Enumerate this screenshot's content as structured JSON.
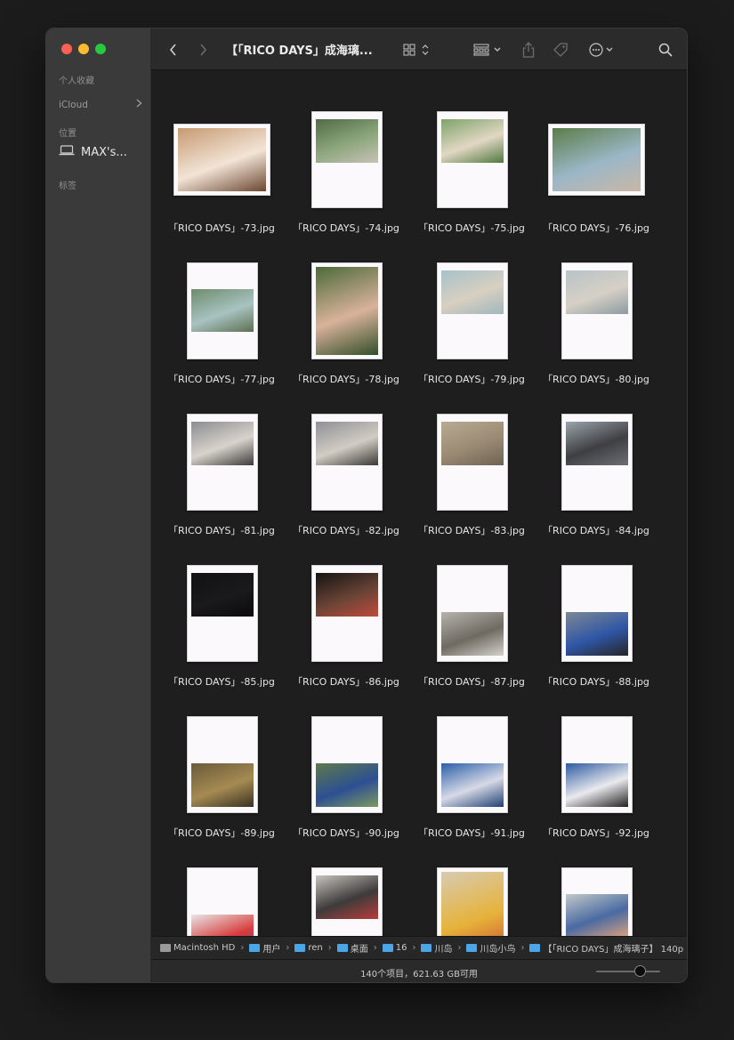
{
  "window": {
    "title": "【「RICO DAYS」成海璃...",
    "traffic_lights": [
      "#fe5f57",
      "#febc2e",
      "#28c840"
    ]
  },
  "sidebar": {
    "favorites_label": "个人收藏",
    "icloud_label": "iCloud",
    "locations_label": "位置",
    "device_name": "MAX's...",
    "tags_label": "标签"
  },
  "toolbar": {
    "back_icon": "chevron-left-icon",
    "forward_icon": "chevron-right-icon",
    "view_icon": "grid-view-icon",
    "group_icon": "group-icon",
    "share_icon": "share-icon",
    "tag_icon": "tag-icon",
    "more_icon": "ellipsis-circle-icon",
    "search_icon": "search-icon"
  },
  "files": [
    {
      "name": "「RICO DAYS」-73.jpg",
      "orient": "landscape",
      "photo": "full",
      "colors": [
        "#c79a72",
        "#f2e4d6",
        "#6b4630"
      ]
    },
    {
      "name": "「RICO DAYS」-74.jpg",
      "orient": "portrait",
      "photo": "top",
      "colors": [
        "#4f6c46",
        "#8ea77e",
        "#c7c2b6"
      ]
    },
    {
      "name": "「RICO DAYS」-75.jpg",
      "orient": "portrait",
      "photo": "top",
      "colors": [
        "#7ea36a",
        "#e2d7c4",
        "#4e7a3e"
      ]
    },
    {
      "name": "「RICO DAYS」-76.jpg",
      "orient": "landscape",
      "photo": "full",
      "colors": [
        "#5c7d49",
        "#9bb7c7",
        "#c9b7a6"
      ]
    },
    {
      "name": "「RICO DAYS」-77.jpg",
      "orient": "portrait",
      "photo": "middle",
      "colors": [
        "#6e8b6d",
        "#a8c3c1",
        "#5d6f52"
      ]
    },
    {
      "name": "「RICO DAYS」-78.jpg",
      "orient": "portrait",
      "photo": "full",
      "colors": [
        "#4d6a3b",
        "#d9b29a",
        "#324f2a"
      ]
    },
    {
      "name": "「RICO DAYS」-79.jpg",
      "orient": "portrait",
      "photo": "top",
      "colors": [
        "#a7c2c9",
        "#d8cfc1",
        "#9fb7bb"
      ]
    },
    {
      "name": "「RICO DAYS」-80.jpg",
      "orient": "portrait",
      "photo": "top",
      "colors": [
        "#b8c3c7",
        "#d6d0c6",
        "#8c9aa1"
      ]
    },
    {
      "name": "「RICO DAYS」-81.jpg",
      "orient": "portrait",
      "photo": "top",
      "colors": [
        "#8b8d92",
        "#d8d3cb",
        "#3b3a3a"
      ]
    },
    {
      "name": "「RICO DAYS」-82.jpg",
      "orient": "portrait",
      "photo": "top",
      "colors": [
        "#8f9196",
        "#d1ccc3",
        "#3a3836"
      ]
    },
    {
      "name": "「RICO DAYS」-83.jpg",
      "orient": "portrait",
      "photo": "top",
      "colors": [
        "#b8aa94",
        "#9a8a74",
        "#6d6253"
      ]
    },
    {
      "name": "「RICO DAYS」-84.jpg",
      "orient": "portrait",
      "photo": "top",
      "colors": [
        "#9aa3ad",
        "#3f3f42",
        "#6a6f76"
      ]
    },
    {
      "name": "「RICO DAYS」-85.jpg",
      "orient": "portrait",
      "photo": "top",
      "colors": [
        "#111012",
        "#1a1a1c",
        "#0b0b0b"
      ]
    },
    {
      "name": "「RICO DAYS」-86.jpg",
      "orient": "portrait",
      "photo": "top",
      "colors": [
        "#151314",
        "#6a4436",
        "#c14a3a"
      ]
    },
    {
      "name": "「RICO DAYS」-87.jpg",
      "orient": "portrait",
      "photo": "bottom",
      "colors": [
        "#b4b4ad",
        "#6f6a61",
        "#d4d2cc"
      ]
    },
    {
      "name": "「RICO DAYS」-88.jpg",
      "orient": "portrait",
      "photo": "bottom",
      "colors": [
        "#7d8894",
        "#2f56a6",
        "#252525"
      ]
    },
    {
      "name": "「RICO DAYS」-89.jpg",
      "orient": "portrait",
      "photo": "bottom",
      "colors": [
        "#6b5a3b",
        "#a58b52",
        "#3a3124"
      ]
    },
    {
      "name": "「RICO DAYS」-90.jpg",
      "orient": "portrait",
      "photo": "bottom",
      "colors": [
        "#5e7b4a",
        "#2d4f93",
        "#7d9a5f"
      ]
    },
    {
      "name": "「RICO DAYS」-91.jpg",
      "orient": "portrait",
      "photo": "bottom",
      "colors": [
        "#2b5fa8",
        "#d7d9e6",
        "#1e3f75"
      ]
    },
    {
      "name": "「RICO DAYS」-92.jpg",
      "orient": "portrait",
      "photo": "bottom",
      "colors": [
        "#2c5aa0",
        "#eaeaee",
        "#222222"
      ]
    },
    {
      "name": "",
      "orient": "portrait",
      "photo": "bottom",
      "colors": [
        "#e7e7e7",
        "#d93a3a",
        "#2f5fb1"
      ]
    },
    {
      "name": "",
      "orient": "portrait",
      "photo": "top",
      "colors": [
        "#c7c3bd",
        "#3d3b3b",
        "#b73d3b"
      ]
    },
    {
      "name": "",
      "orient": "portrait",
      "photo": "full",
      "colors": [
        "#d8cbb1",
        "#e6b23a",
        "#c94a2f"
      ]
    },
    {
      "name": "",
      "orient": "portrait",
      "photo": "middle",
      "colors": [
        "#c2c9c9",
        "#4a6aa2",
        "#d9a17f"
      ]
    }
  ],
  "pathbar": {
    "items": [
      {
        "label": "Macintosh HD",
        "icon": "hard-drive-icon"
      },
      {
        "label": "用户",
        "icon": "folder-icon"
      },
      {
        "label": "ren",
        "icon": "folder-icon"
      },
      {
        "label": "桌面",
        "icon": "folder-icon"
      },
      {
        "label": "16\u0000",
        "icon": "folder-icon"
      },
      {
        "label": "川岛",
        "icon": "folder-icon"
      },
      {
        "label": "川岛小鸟",
        "icon": "folder-icon"
      },
      {
        "label": "【「RICO DAYS」成海璃子】 140p",
        "icon": "folder-icon"
      }
    ]
  },
  "status": {
    "text": "140个项目，621.63 GB可用",
    "zoom_level": 0.7
  }
}
